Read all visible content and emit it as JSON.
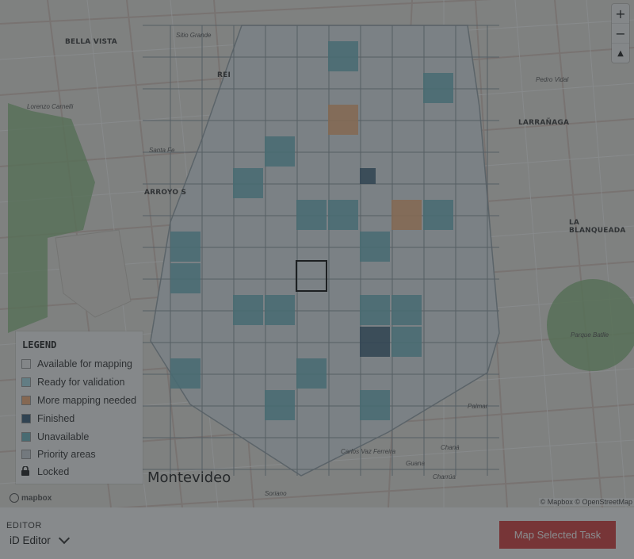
{
  "map": {
    "places": [
      {
        "id": "bella-vista",
        "label": "BELLA VISTA"
      },
      {
        "id": "arroyo-seco",
        "label": "ARROYO S"
      },
      {
        "id": "larranaga",
        "label": "LARRAÑAGA"
      },
      {
        "id": "la-blanqueada",
        "label": "LA BLANQUEADA"
      },
      {
        "id": "reducto",
        "label": "REI"
      }
    ],
    "streets": [
      "Sitio Grande",
      "Lorenzo Carnelli",
      "Santa Fe",
      "Pedro Vidal",
      "Palmar",
      "Guana",
      "Chaná",
      "Charrúa",
      "Soriano",
      "Carlos Vaz Ferreira",
      "Parque Batlle"
    ],
    "city_label": "Montevideo",
    "attribution": "© Mapbox © OpenStreetMap",
    "logo_text": "mapbox"
  },
  "zoom": {
    "in": "+",
    "out": "−",
    "compass": "▲"
  },
  "legend": {
    "title": "LEGEND",
    "items": [
      {
        "label": "Available for mapping",
        "color": "#f2f2f2"
      },
      {
        "label": "Ready for validation",
        "color": "#a9dde8"
      },
      {
        "label": "More mapping needed",
        "color": "#f5b07a"
      },
      {
        "label": "Finished",
        "color": "#3b5e7a"
      },
      {
        "label": "Unavailable",
        "color": "#6fb5c1"
      },
      {
        "label": "Priority areas",
        "color": "#cfd6dc"
      },
      {
        "label": "Locked",
        "icon": "lock-icon"
      }
    ]
  },
  "footer": {
    "editor_label": "EDITOR",
    "editor_value": "iD Editor",
    "map_button": "Map Selected Task"
  },
  "colors": {
    "accent": "#d73f3f",
    "overlay": "#2d3236"
  }
}
